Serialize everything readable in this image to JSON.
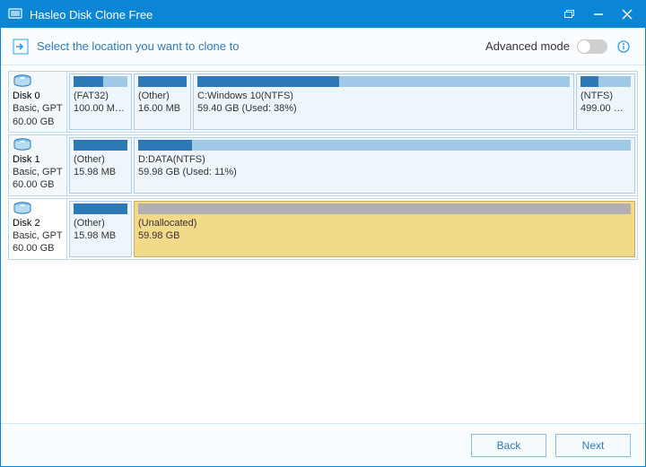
{
  "title": "Hasleo Disk Clone Free",
  "header": {
    "prompt": "Select the location you want to clone to",
    "advanced_label": "Advanced mode",
    "advanced_on": false
  },
  "disks": [
    {
      "name": "Disk 0",
      "meta": "Basic, GPT",
      "size": "60.00 GB",
      "selected": false,
      "partitions": [
        {
          "label": "(FAT32)",
          "size_line": "100.00 MB ...",
          "used_pct": 55,
          "width": 70,
          "type": "alloc"
        },
        {
          "label": "(Other)",
          "size_line": "16.00 MB",
          "used_pct": 100,
          "width": 64,
          "type": "alloc"
        },
        {
          "label": "C:Windows 10(NTFS)",
          "size_line": "59.40 GB (Used: 38%)",
          "used_pct": 38,
          "width": 0,
          "flex": true,
          "type": "alloc"
        },
        {
          "label": "(NTFS)",
          "size_line": "499.00 MB ...",
          "used_pct": 35,
          "width": 66,
          "type": "alloc"
        }
      ]
    },
    {
      "name": "Disk 1",
      "meta": "Basic, GPT",
      "size": "60.00 GB",
      "selected": false,
      "partitions": [
        {
          "label": "(Other)",
          "size_line": "15.98 MB",
          "used_pct": 100,
          "width": 70,
          "type": "alloc"
        },
        {
          "label": "D:DATA(NTFS)",
          "size_line": "59.98 GB (Used: 11%)",
          "used_pct": 11,
          "width": 0,
          "flex": true,
          "type": "alloc"
        }
      ]
    },
    {
      "name": "Disk 2",
      "meta": "Basic, GPT",
      "size": "60.00 GB",
      "selected": true,
      "partitions": [
        {
          "label": "(Other)",
          "size_line": "15.98 MB",
          "used_pct": 100,
          "width": 70,
          "type": "alloc"
        },
        {
          "label": "(Unallocated)",
          "size_line": "59.98 GB",
          "used_pct": 100,
          "width": 0,
          "flex": true,
          "type": "unalloc"
        }
      ]
    }
  ],
  "footer": {
    "back_label": "Back",
    "next_label": "Next"
  }
}
